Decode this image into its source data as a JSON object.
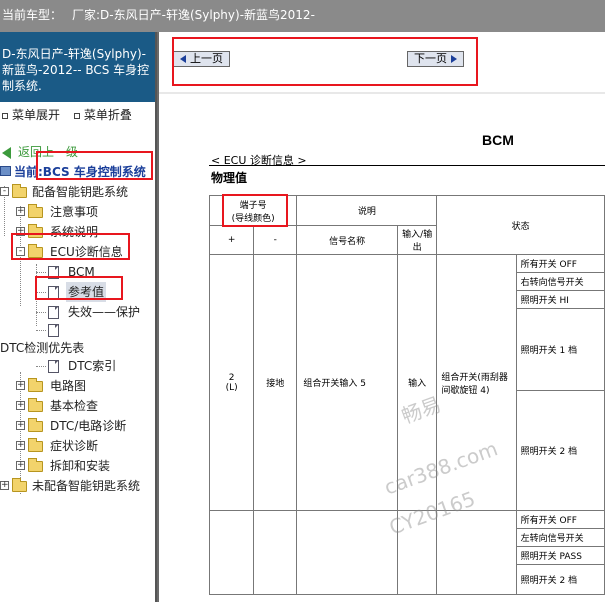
{
  "topbar": {
    "current_model_label": "当前车型：",
    "model": "厂家:D-东风日产-轩逸(Sylphy)-新蓝鸟2012-"
  },
  "left": {
    "header_text": "D-东风日产-轩逸(Sylphy)-新蓝鸟-2012-- BCS 车身控制系统.",
    "menu_expand": "菜单展开",
    "menu_collapse": "菜单折叠",
    "tree": {
      "back": "返回上一级",
      "current": "当前:BCS 车身控制系统",
      "smart_key": "配备智能钥匙系统",
      "notes": "注意事项",
      "sys_desc": "系统说明",
      "ecu_diag": "ECU诊断信息",
      "bcm": "BCM",
      "ref_value": "参考值",
      "failsafe": "失效——保护",
      "dtc_priority": "DTC检测优先表",
      "dtc_index": "DTC索引",
      "wiring": "电路图",
      "basic_check": "基本检查",
      "dtc_circuit": "DTC/电路诊断",
      "symptom": "症状诊断",
      "removal": "拆卸和安装",
      "no_smart_key": "未配备智能钥匙系统"
    }
  },
  "nav": {
    "prev": "上一页",
    "next": "下一页"
  },
  "doc": {
    "title": "BCM",
    "crumb": "< ECU 诊断信息 >",
    "section": "物理值",
    "table": {
      "h_terminal": "端子号",
      "h_wire_color": "(导线颜色)",
      "h_desc": "说明",
      "h_state": "状态",
      "h_plus": "+",
      "h_minus": "-",
      "h_signal": "信号名称",
      "h_io": "输入/输出",
      "terminal": "2",
      "terminal_color": "(L)",
      "minus_val": "接地",
      "signal_name": "组合开关输入 5",
      "io_val": "输入",
      "state_desc": "组合开关(雨刮器间歇旋钮 4)",
      "states_a": [
        "所有开关 OFF",
        "右转向信号开关",
        "照明开关 HI",
        "照明开关 1 档",
        "照明开关 2 档"
      ],
      "states_b": [
        "所有开关 OFF",
        "左转向信号开关",
        "照明开关 PASS",
        "照明开关 2 档"
      ]
    }
  },
  "watermark": {
    "line1": "畅易",
    "line2": "car388.com",
    "line3": "CY20165"
  },
  "colors": {
    "highlight_border": "#e8161e",
    "left_header_bg": "#1a5a86",
    "topbar_bg": "#8a8a8a"
  }
}
